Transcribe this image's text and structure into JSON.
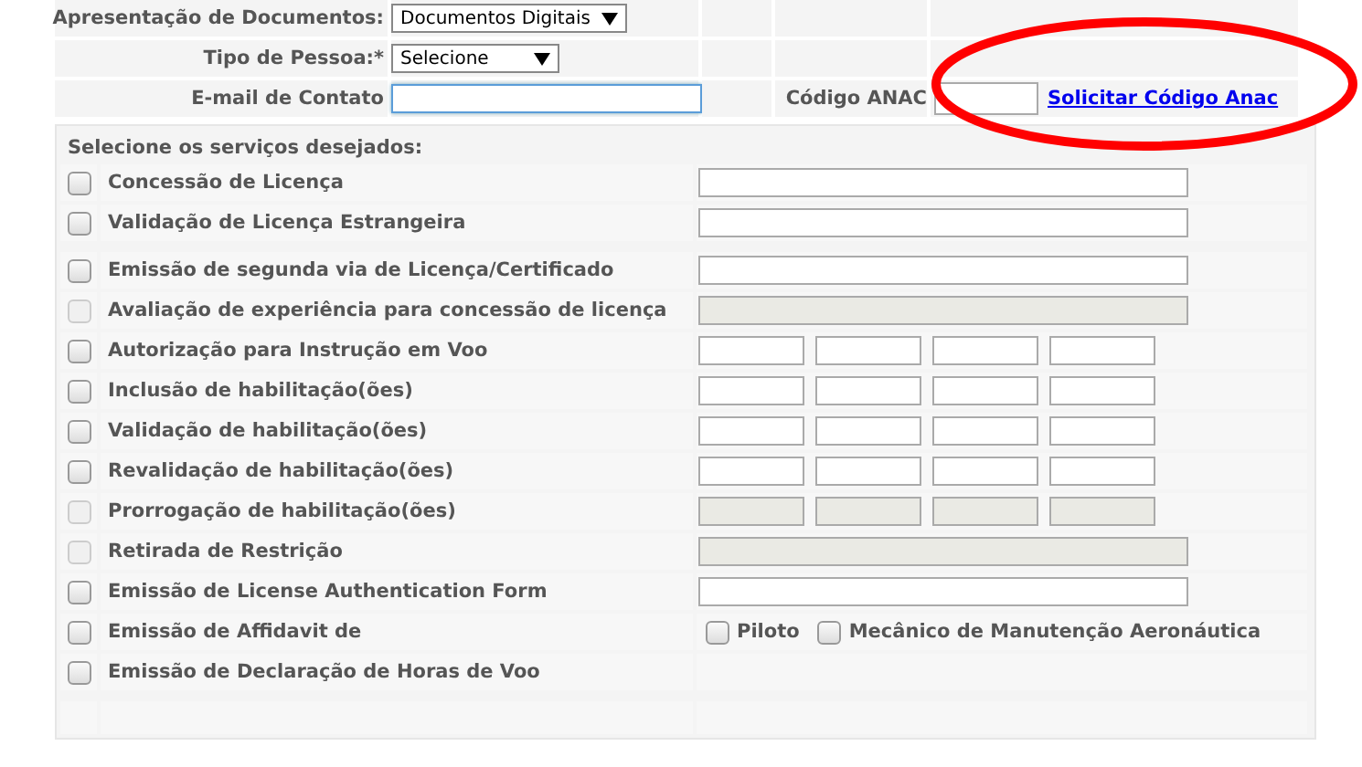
{
  "header_rows": [
    {
      "label": "Apresentação de Documentos:",
      "kind": "select",
      "value": "Documentos Digitais"
    },
    {
      "label": "Tipo de Pessoa:*",
      "kind": "select",
      "value": "Selecione"
    },
    {
      "label": "E-mail de Contato",
      "kind": "input",
      "value": "",
      "focused": true,
      "extra_label": "Código ANAC",
      "extra_link": "Solicitar Código Anac"
    }
  ],
  "services": {
    "title": "Selecione os serviços desejados:",
    "groups": [
      [
        {
          "label": "Concessão de Licença",
          "kind": "single",
          "checked": false,
          "disabled": false
        },
        {
          "label": "Validação de Licença Estrangeira",
          "kind": "single",
          "checked": false,
          "disabled": false
        }
      ],
      [
        {
          "label": "Emissão de segunda via de Licença/Certificado",
          "kind": "single",
          "checked": false,
          "disabled": false
        },
        {
          "label": "Avaliação de experiência para concessão de licença",
          "kind": "single",
          "checked": false,
          "disabled": true
        },
        {
          "label": "Autorização para Instrução em Voo",
          "kind": "quad",
          "checked": false,
          "disabled": false
        },
        {
          "label": "Inclusão de habilitação(ões)",
          "kind": "quad",
          "checked": false,
          "disabled": false
        },
        {
          "label": "Validação de habilitação(ões)",
          "kind": "quad",
          "checked": false,
          "disabled": false
        },
        {
          "label": "Revalidação de habilitação(ões)",
          "kind": "quad",
          "checked": false,
          "disabled": false
        },
        {
          "label": "Prorrogação de habilitação(ões)",
          "kind": "quad",
          "checked": false,
          "disabled": true
        },
        {
          "label": "Retirada de Restrição",
          "kind": "single",
          "checked": false,
          "disabled": true
        },
        {
          "label": "Emissão de License Authentication Form",
          "kind": "single",
          "checked": false,
          "disabled": false
        },
        {
          "label": "Emissão de Affidavit de",
          "kind": "options",
          "checked": false,
          "disabled": false,
          "options": [
            {
              "label": "Piloto",
              "checked": false
            },
            {
              "label": "Mecânico de Manutenção Aeronáutica",
              "checked": false
            }
          ]
        },
        {
          "label": "Emissão de Declaração de Horas de Voo",
          "kind": "none",
          "checked": false,
          "disabled": false
        }
      ]
    ]
  }
}
